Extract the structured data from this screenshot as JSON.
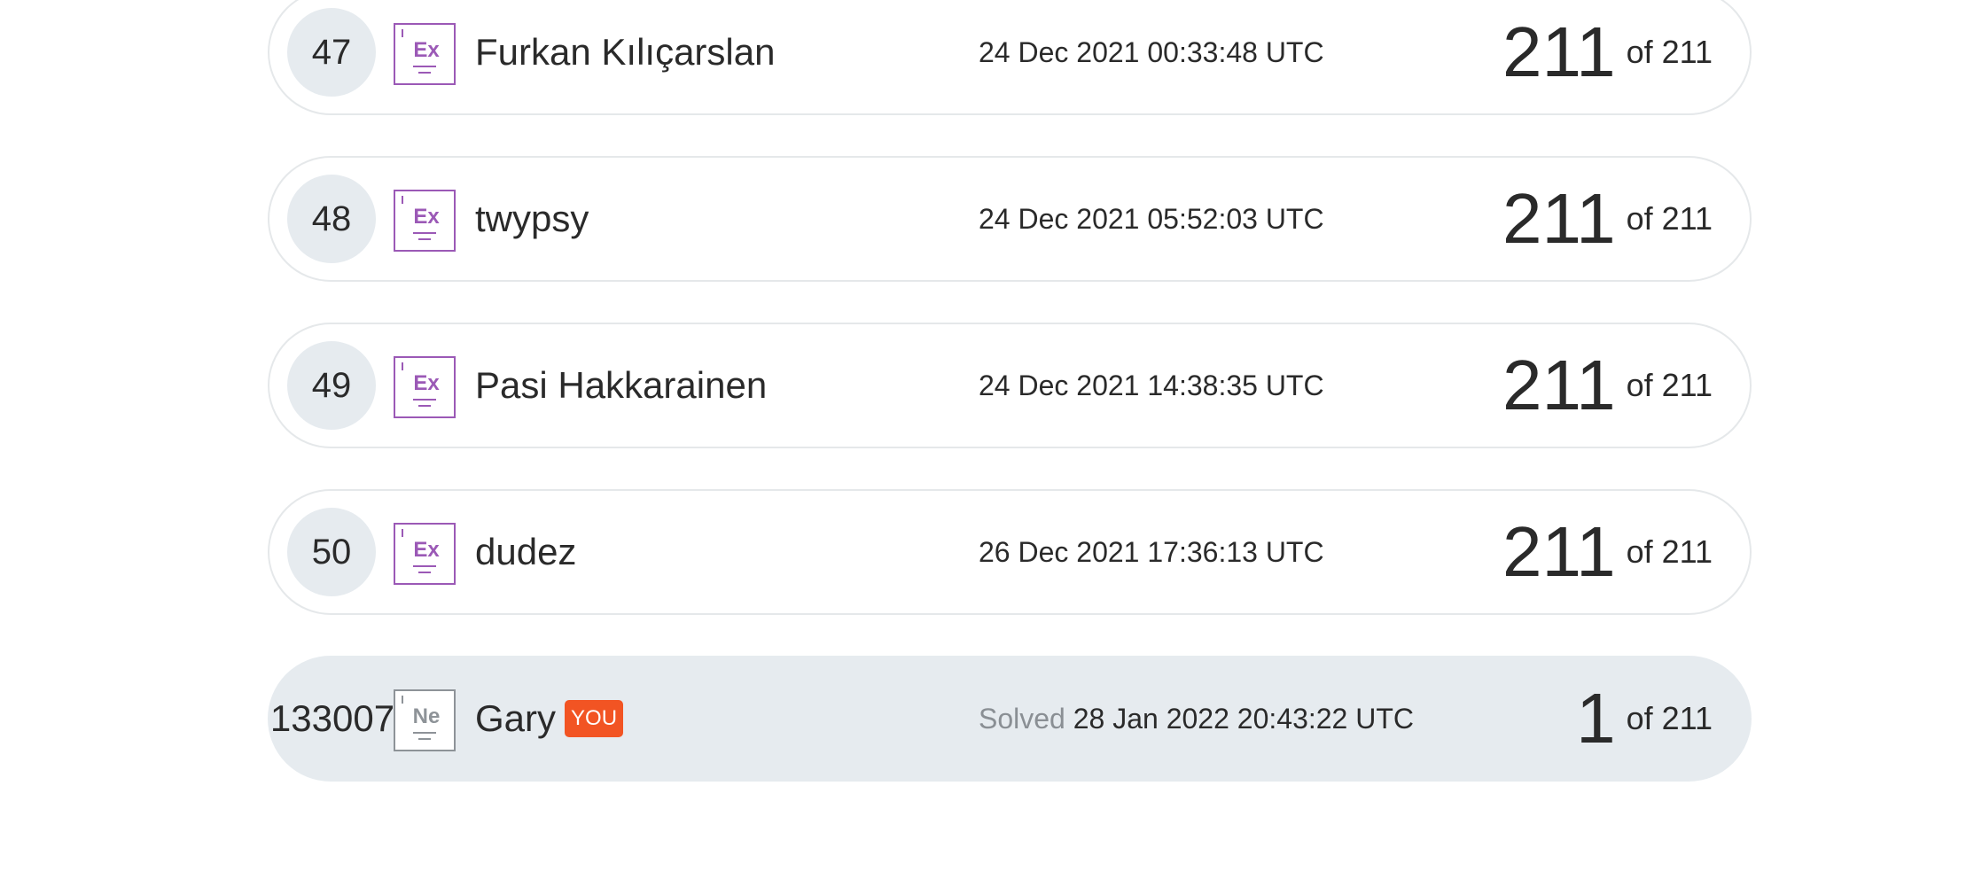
{
  "leaderboard": {
    "rows": [
      {
        "rank": "47",
        "level_icon": "excellent-level-icon",
        "level_abbr": "Ex",
        "name": "Furkan Kılıçarslan",
        "time": "24 Dec 2021 00:33:48 UTC",
        "score": "211",
        "of": "of 211"
      },
      {
        "rank": "48",
        "level_icon": "excellent-level-icon",
        "level_abbr": "Ex",
        "name": "twypsy",
        "time": "24 Dec 2021 05:52:03 UTC",
        "score": "211",
        "of": "of 211"
      },
      {
        "rank": "49",
        "level_icon": "excellent-level-icon",
        "level_abbr": "Ex",
        "name": "Pasi Hakkarainen",
        "time": "24 Dec 2021 14:38:35 UTC",
        "score": "211",
        "of": "of 211"
      },
      {
        "rank": "50",
        "level_icon": "excellent-level-icon",
        "level_abbr": "Ex",
        "name": "dudez",
        "time": "26 Dec 2021 17:36:13 UTC",
        "score": "211",
        "of": "of 211"
      }
    ],
    "you_row": {
      "rank": "133007",
      "level_icon": "newbie-level-icon",
      "level_abbr": "Ne",
      "name": "Gary",
      "you_label": "YOU",
      "solved_label": "Solved",
      "time": "28 Jan 2022 20:43:22 UTC",
      "score": "1",
      "of": "of 211"
    }
  },
  "colors": {
    "excellent_badge": "#9b59b6",
    "newbie_badge": "#8e9398",
    "you_tag": "#f25423",
    "you_row_bg": "#e6ebef"
  }
}
